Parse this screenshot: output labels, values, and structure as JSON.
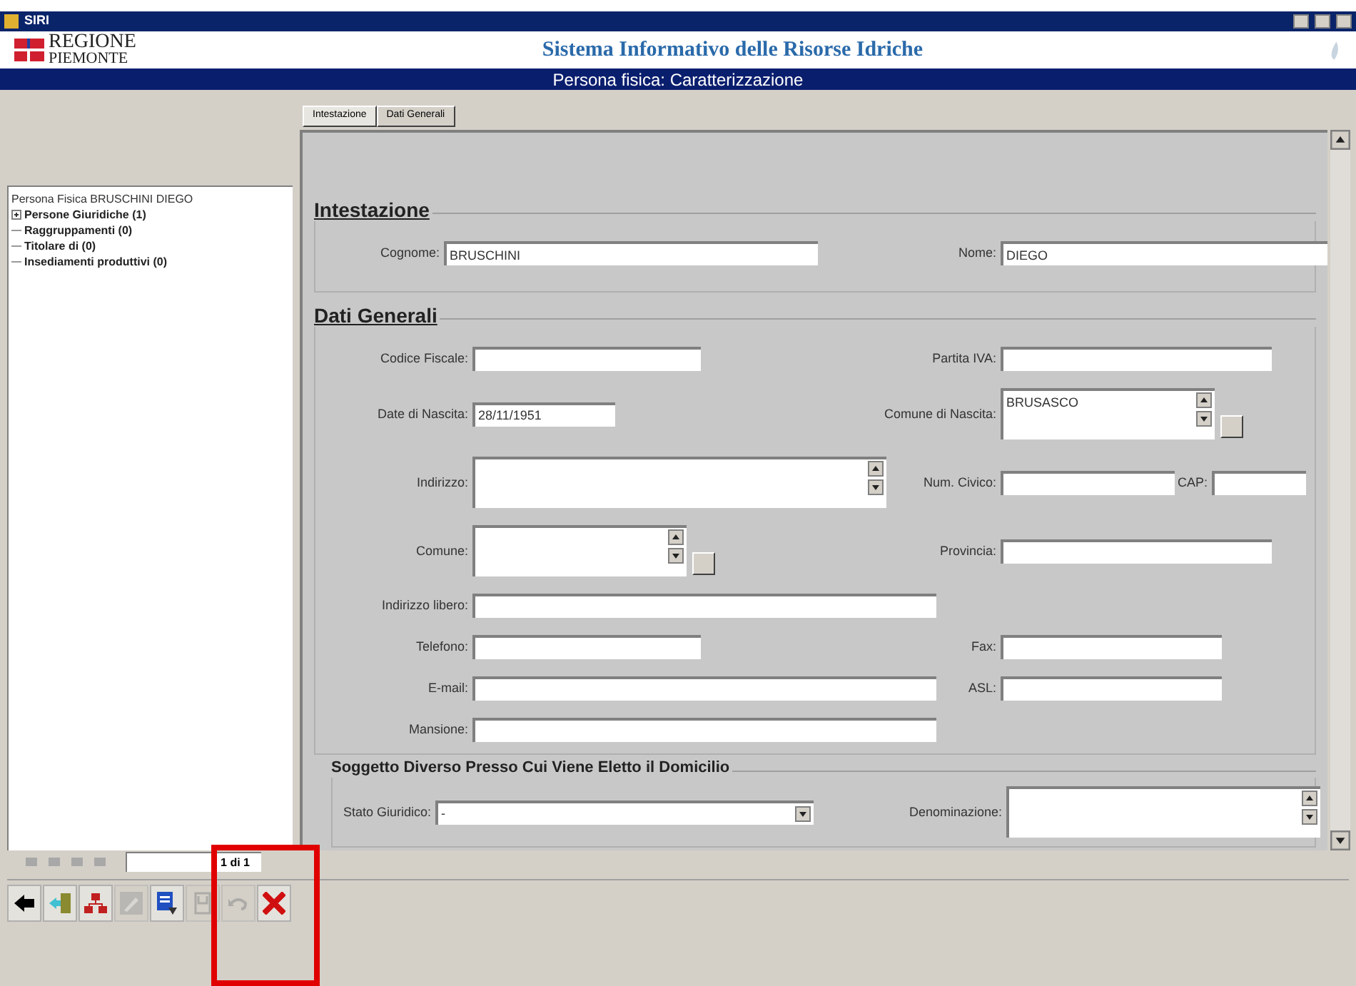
{
  "window": {
    "title": "SIRI"
  },
  "header": {
    "logo_lines": [
      "REGIONE",
      "PIEMONTE"
    ],
    "system_title": "Sistema Informativo delle Risorse Idriche"
  },
  "page_title": "Persona fisica: Caratterizzazione",
  "tabs": [
    {
      "label": "Intestazione",
      "selected": true
    },
    {
      "label": "Dati Generali",
      "selected": false
    }
  ],
  "tree": {
    "label": "Persona Fisica BRUSCHINI DIEGO",
    "children": [
      {
        "label": "Persone Giuridiche (1)",
        "kind": "collapsed"
      },
      {
        "label": "Raggruppamenti (0)",
        "kind": "leaf"
      },
      {
        "label": "Titolare di (0)",
        "kind": "leaf"
      },
      {
        "label": "Insediamenti produttivi (0)",
        "kind": "leaf"
      }
    ]
  },
  "sections": [
    {
      "title": "Intestazione",
      "kind": "main",
      "rows": [
        {
          "left": {
            "label": "Cognome:",
            "kind": "name",
            "value": "BRUSCHINI"
          },
          "right": {
            "label": "Nome:",
            "kind": "name",
            "value": "DIEGO"
          }
        }
      ]
    },
    {
      "title": "Dati Generali",
      "kind": "main",
      "rows": [
        {
          "left": {
            "label": "Codice Fiscale:",
            "kind": "short"
          },
          "right": {
            "label": "Partita IVA:",
            "kind": "medium"
          }
        },
        {
          "left": {
            "label": "Date di Nascita:",
            "kind": "date",
            "value": "28/11/1951"
          },
          "right": {
            "label": "Comune di Nascita:",
            "kind": "lookup",
            "value": "BRUSASCO"
          }
        },
        {
          "left": {
            "label": "Indirizzo:",
            "kind": "memo"
          },
          "right": {
            "label": "Num. Civico:",
            "kind": "num"
          },
          "extra": {
            "label": "CAP:",
            "kind": "tiny"
          }
        },
        {
          "left": {
            "label": "Comune:",
            "kind": "lookup"
          },
          "right": {
            "label": "Provincia:",
            "kind": "medium"
          }
        },
        {
          "left": {
            "label": "Indirizzo libero:",
            "kind": "long"
          }
        },
        {
          "left": {
            "label": "Telefono:",
            "kind": "short"
          },
          "right": {
            "label": "Fax:",
            "kind": "civic"
          }
        },
        {
          "left": {
            "label": "E-mail:",
            "kind": "long"
          },
          "right": {
            "label": "ASL:",
            "kind": "civic"
          }
        },
        {
          "left": {
            "label": "Mansione:",
            "kind": "long"
          }
        }
      ]
    },
    {
      "title": "Soggetto Diverso Presso Cui Viene Eletto il Domicilio",
      "kind": "sub",
      "rows": [
        {
          "left": {
            "label": "Stato Giuridico:",
            "kind": "select",
            "value": "-"
          },
          "right": {
            "label": "Denominazione:",
            "kind": "memo2"
          }
        }
      ]
    }
  ],
  "pager": {
    "text": "1 di 1"
  },
  "toolbar": [
    {
      "kind": "back",
      "disabled": false
    },
    {
      "kind": "exit",
      "disabled": false
    },
    {
      "kind": "tree",
      "disabled": false
    },
    {
      "kind": "edit",
      "disabled": true
    },
    {
      "kind": "report",
      "disabled": false
    },
    {
      "kind": "save",
      "disabled": true
    },
    {
      "kind": "undo",
      "disabled": true
    },
    {
      "kind": "delete",
      "disabled": false
    }
  ]
}
